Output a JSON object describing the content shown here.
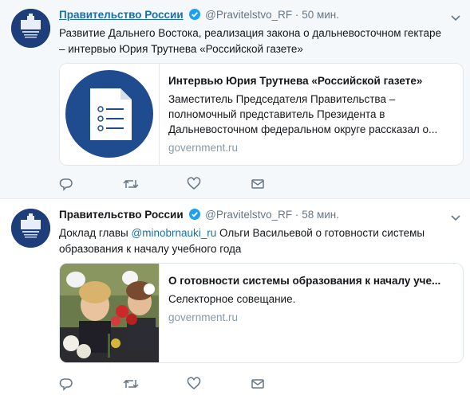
{
  "tweets": [
    {
      "author": "Правительство России",
      "handle": "@Pravitelstvo_RF",
      "dot": "·",
      "time": "50 мин.",
      "text": "Развитие Дальнего Востока, реализация закона о дальневосточном гектаре – интервью Юрия Трутнева «Российской газете»",
      "card": {
        "title": "Интервью Юрия Трутнева «Российской газете»",
        "description": "Заместитель Председателя Правительства – полномочный представитель Президента в Дальневосточном федеральном округе рассказал о...",
        "domain": "government.ru",
        "image": "document-icon"
      }
    },
    {
      "author": "Правительство России",
      "handle": "@Pravitelstvo_RF",
      "dot": "·",
      "time": "58 мин.",
      "text_before": "Доклад главы ",
      "mention": "@minobrnauki_ru",
      "text_after": " Ольги Васильевой о готовности системы образования к началу учебного года",
      "card": {
        "title": "О готовности системы образования к началу уче...",
        "description": "Селекторное совещание.",
        "domain": "government.ru",
        "image": "schoolchildren-photo"
      }
    }
  ],
  "actions": [
    "reply-icon",
    "retweet-icon",
    "like-icon",
    "message-icon"
  ],
  "colors": {
    "link": "#1b6fa8",
    "verified": "#1da1f2",
    "muted": "#657786",
    "icon": "#657786",
    "avatar_bg": "#1d3e7a",
    "doc_circle": "#1f4c8f"
  }
}
